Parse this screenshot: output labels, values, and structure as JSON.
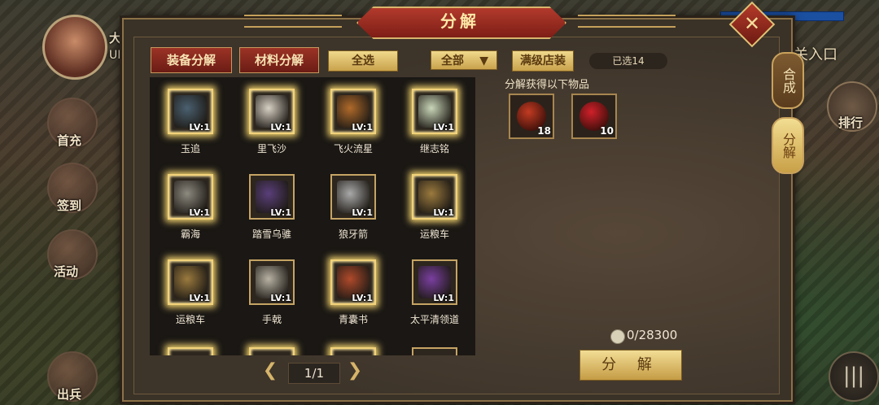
{
  "panel": {
    "title": "分解",
    "close_symbol": "✕"
  },
  "toolbar": {
    "tab_equipment": "装备分解",
    "tab_material": "材料分解",
    "select_all": "全选",
    "filter": "全部",
    "filter_arrow": "▼",
    "max_shop": "满级店装",
    "selected_count": "已选14"
  },
  "rewards": {
    "label": "分解获得以下物品",
    "items": [
      {
        "count": "18",
        "color": "#c23b22"
      },
      {
        "count": "10",
        "color": "#d0202a"
      }
    ]
  },
  "items": [
    {
      "name": "玉追",
      "lv": "LV:1",
      "selected": true,
      "color": "#4a6070"
    },
    {
      "name": "里飞沙",
      "lv": "LV:1",
      "selected": true,
      "color": "#d7d0c4"
    },
    {
      "name": "飞火流星",
      "lv": "LV:1",
      "selected": true,
      "color": "#b06a2a"
    },
    {
      "name": "继志铭",
      "lv": "LV:1",
      "selected": true,
      "color": "#c9d6b8"
    },
    {
      "name": "霸海",
      "lv": "LV:1",
      "selected": true,
      "color": "#8d8a80"
    },
    {
      "name": "踏雪乌骓",
      "lv": "LV:1",
      "selected": false,
      "color": "#5a3f7a"
    },
    {
      "name": "狼牙箭",
      "lv": "LV:1",
      "selected": false,
      "color": "#a9a9a9"
    },
    {
      "name": "运粮车",
      "lv": "LV:1",
      "selected": true,
      "color": "#9b7a3e"
    },
    {
      "name": "运粮车",
      "lv": "LV:1",
      "selected": true,
      "color": "#9b7a3e"
    },
    {
      "name": "手戟",
      "lv": "LV:1",
      "selected": false,
      "color": "#b8b2a4"
    },
    {
      "name": "青囊书",
      "lv": "LV:1",
      "selected": true,
      "color": "#b04a2b"
    },
    {
      "name": "太平清领道",
      "lv": "LV:1",
      "selected": false,
      "color": "#7a3fa0"
    }
  ],
  "pager": {
    "prev": "❮",
    "next": "❯",
    "page": "1/1"
  },
  "cost": {
    "value": "0/28300"
  },
  "decompose_button": "分 解",
  "side_tabs": {
    "compose": "合成",
    "decompose": "分解"
  },
  "background": {
    "uid_label": "UID",
    "name_fragment": "大",
    "gate_text": "关入口",
    "menu_first": "首充",
    "menu_signin": "签到",
    "menu_activity": "活动",
    "menu_battle": "出兵",
    "menu_rank": "排行",
    "menu_icon": "|||"
  }
}
